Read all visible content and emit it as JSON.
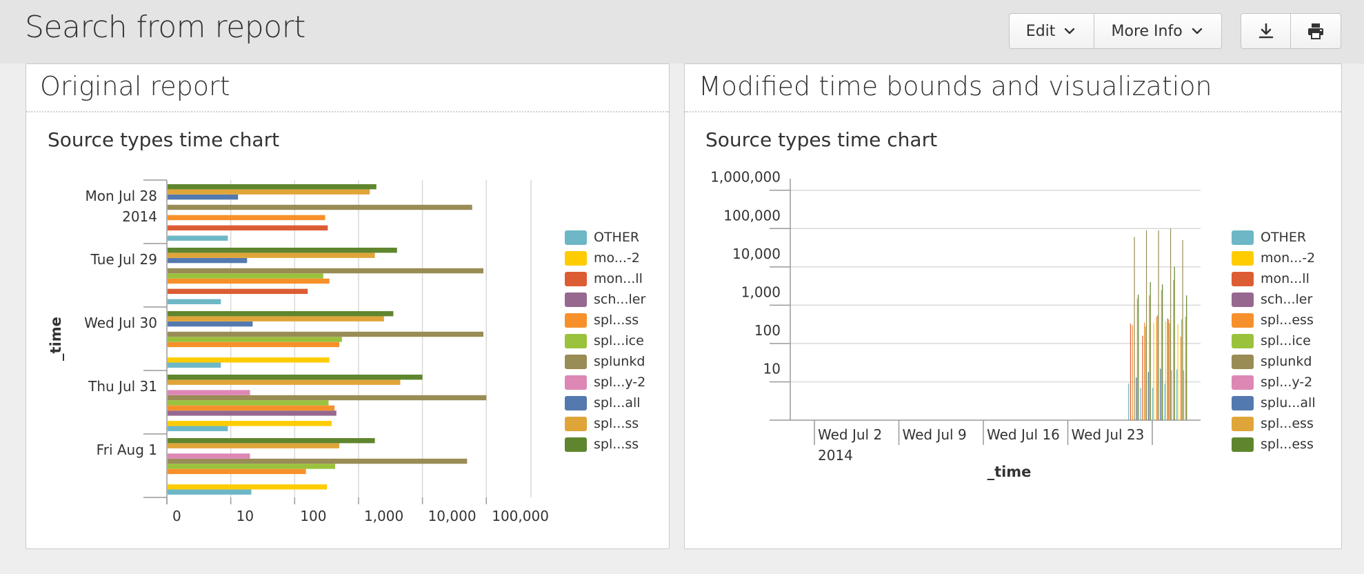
{
  "page": {
    "title": "Search from report",
    "edit_label": "Edit",
    "more_info_label": "More Info"
  },
  "colors": {
    "other": "#6db7c6",
    "mon2": "#fecc00",
    "monll": "#dc5c34",
    "scheduler": "#96688f",
    "spl_ss_orange": "#f7902b",
    "spl_ice": "#9ac23c",
    "splunkd": "#998c55",
    "spl_y2": "#dd87b5",
    "spl_all": "#5479af",
    "spl_ss_gold": "#e0a539",
    "spl_ss_green": "#5f862e"
  },
  "panels": [
    {
      "title": "Original report",
      "chart_title": "Source types time chart",
      "legend": [
        "OTHER",
        "mo...-2",
        "mon...ll",
        "sch...ler",
        "spl...ss",
        "spl...ice",
        "splunkd",
        "spl...y-2",
        "spl...all",
        "spl...ss",
        "spl...ss"
      ]
    },
    {
      "title": "Modified time bounds and visualization",
      "chart_title": "Source types time chart",
      "legend": [
        "OTHER",
        "mon...-2",
        "mon...ll",
        "sch...ler",
        "spl...ess",
        "spl...ice",
        "splunkd",
        "spl...y-2",
        "splu...all",
        "spl...ess",
        "spl...ess"
      ]
    }
  ],
  "chart_data": [
    {
      "type": "bar",
      "orientation": "horizontal",
      "title": "Source types time chart",
      "ylabel": "_time",
      "xlabel": "",
      "x_scale": "log",
      "xlim": [
        1,
        500000
      ],
      "x_tick_labels": [
        "0",
        "10",
        "100",
        "1,000",
        "10,000",
        "100,000"
      ],
      "categories": [
        "Mon Jul 28\n2014",
        "Tue Jul 29",
        "Wed Jul 30",
        "Thu Jul 31",
        "Fri Aug 1"
      ],
      "legend_position": "right",
      "grid": true,
      "series": [
        {
          "name": "OTHER",
          "values": [
            9,
            7,
            7,
            9,
            21
          ]
        },
        {
          "name": "mo...-2",
          "values": [
            0,
            0,
            350,
            380,
            320
          ]
        },
        {
          "name": "mon...ll",
          "values": [
            330,
            160,
            0,
            0,
            0
          ]
        },
        {
          "name": "sch...ler",
          "values": [
            0,
            0,
            0,
            450,
            0
          ]
        },
        {
          "name": "spl...ss",
          "values": [
            300,
            350,
            500,
            420,
            150
          ]
        },
        {
          "name": "spl...ice",
          "values": [
            0,
            280,
            550,
            340,
            430
          ]
        },
        {
          "name": "splunkd",
          "values": [
            60000,
            90000,
            90000,
            100000,
            50000
          ]
        },
        {
          "name": "spl...y-2",
          "values": [
            0,
            0,
            0,
            20,
            20
          ]
        },
        {
          "name": "spl...all",
          "values": [
            13,
            18,
            22,
            0,
            0
          ]
        },
        {
          "name": "spl...ss",
          "values": [
            1500,
            1800,
            2500,
            4500,
            500
          ]
        },
        {
          "name": "spl...ss",
          "values": [
            1900,
            4000,
            3500,
            10000,
            1800
          ]
        }
      ]
    },
    {
      "type": "bar",
      "title": "Source types time chart",
      "xlabel": "_time",
      "ylabel": "",
      "y_scale": "log",
      "ylim": [
        1,
        2000000
      ],
      "y_tick_labels": [
        "10",
        "100",
        "1,000",
        "10,000",
        "100,000",
        "1,000,000"
      ],
      "x_tick_labels": [
        "Wed Jul 2\n2014",
        "Wed Jul 9",
        "Wed Jul 16",
        "Wed Jul 23"
      ],
      "xlim": [
        "2014-06-30",
        "2014-08-03"
      ],
      "legend_position": "right",
      "grid": true,
      "categories": [
        "2014-07-28",
        "2014-07-29",
        "2014-07-30",
        "2014-07-31",
        "2014-08-01"
      ],
      "series": [
        {
          "name": "OTHER",
          "values": [
            9,
            7,
            7,
            9,
            21
          ]
        },
        {
          "name": "mon...-2",
          "values": [
            0,
            0,
            350,
            380,
            320
          ]
        },
        {
          "name": "mon...ll",
          "values": [
            330,
            160,
            0,
            0,
            0
          ]
        },
        {
          "name": "sch...ler",
          "values": [
            0,
            0,
            0,
            450,
            0
          ]
        },
        {
          "name": "spl...ess",
          "values": [
            300,
            350,
            500,
            420,
            150
          ]
        },
        {
          "name": "spl...ice",
          "values": [
            0,
            280,
            550,
            340,
            430
          ]
        },
        {
          "name": "splunkd",
          "values": [
            60000,
            90000,
            90000,
            100000,
            50000
          ]
        },
        {
          "name": "spl...y-2",
          "values": [
            0,
            0,
            0,
            20,
            20
          ]
        },
        {
          "name": "splu...all",
          "values": [
            13,
            18,
            22,
            0,
            0
          ]
        },
        {
          "name": "spl...ess",
          "values": [
            1500,
            1800,
            2500,
            4500,
            500
          ]
        },
        {
          "name": "spl...ess",
          "values": [
            1900,
            4000,
            3500,
            10000,
            1800
          ]
        }
      ]
    }
  ]
}
